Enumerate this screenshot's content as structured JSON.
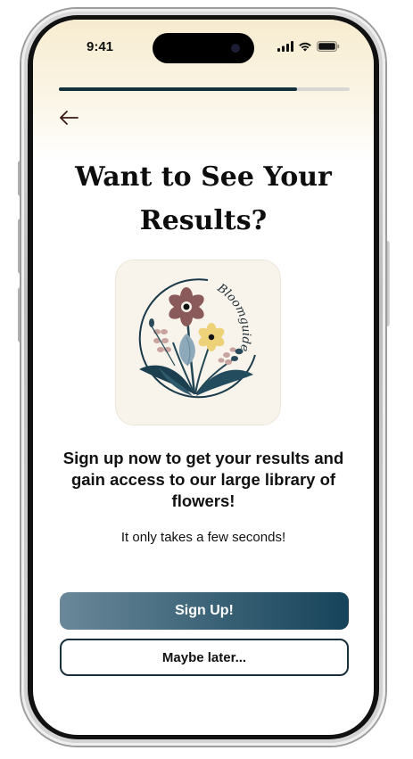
{
  "status_bar": {
    "time": "9:41",
    "icons": [
      "signal-icon",
      "wifi-icon",
      "battery-icon"
    ]
  },
  "onboarding": {
    "progress": 0.82,
    "back_icon": "arrow-left-icon",
    "headline": "Want to See Your Results?",
    "logo": {
      "brand_text": "Bloomguide",
      "icon": "flower-bouquet-logo"
    },
    "subheadline": "Sign up now to get your results and gain access to our large library of flowers!",
    "caption": "It only takes a few seconds!",
    "primary_button": "Sign Up!",
    "secondary_button": "Maybe later..."
  },
  "colors": {
    "accent_dark": "#16303b",
    "gradient_start": "#6a8899",
    "gradient_end": "#16435a",
    "top_glow": "#f7ecd0",
    "logo_background": "#f8f4ec"
  }
}
